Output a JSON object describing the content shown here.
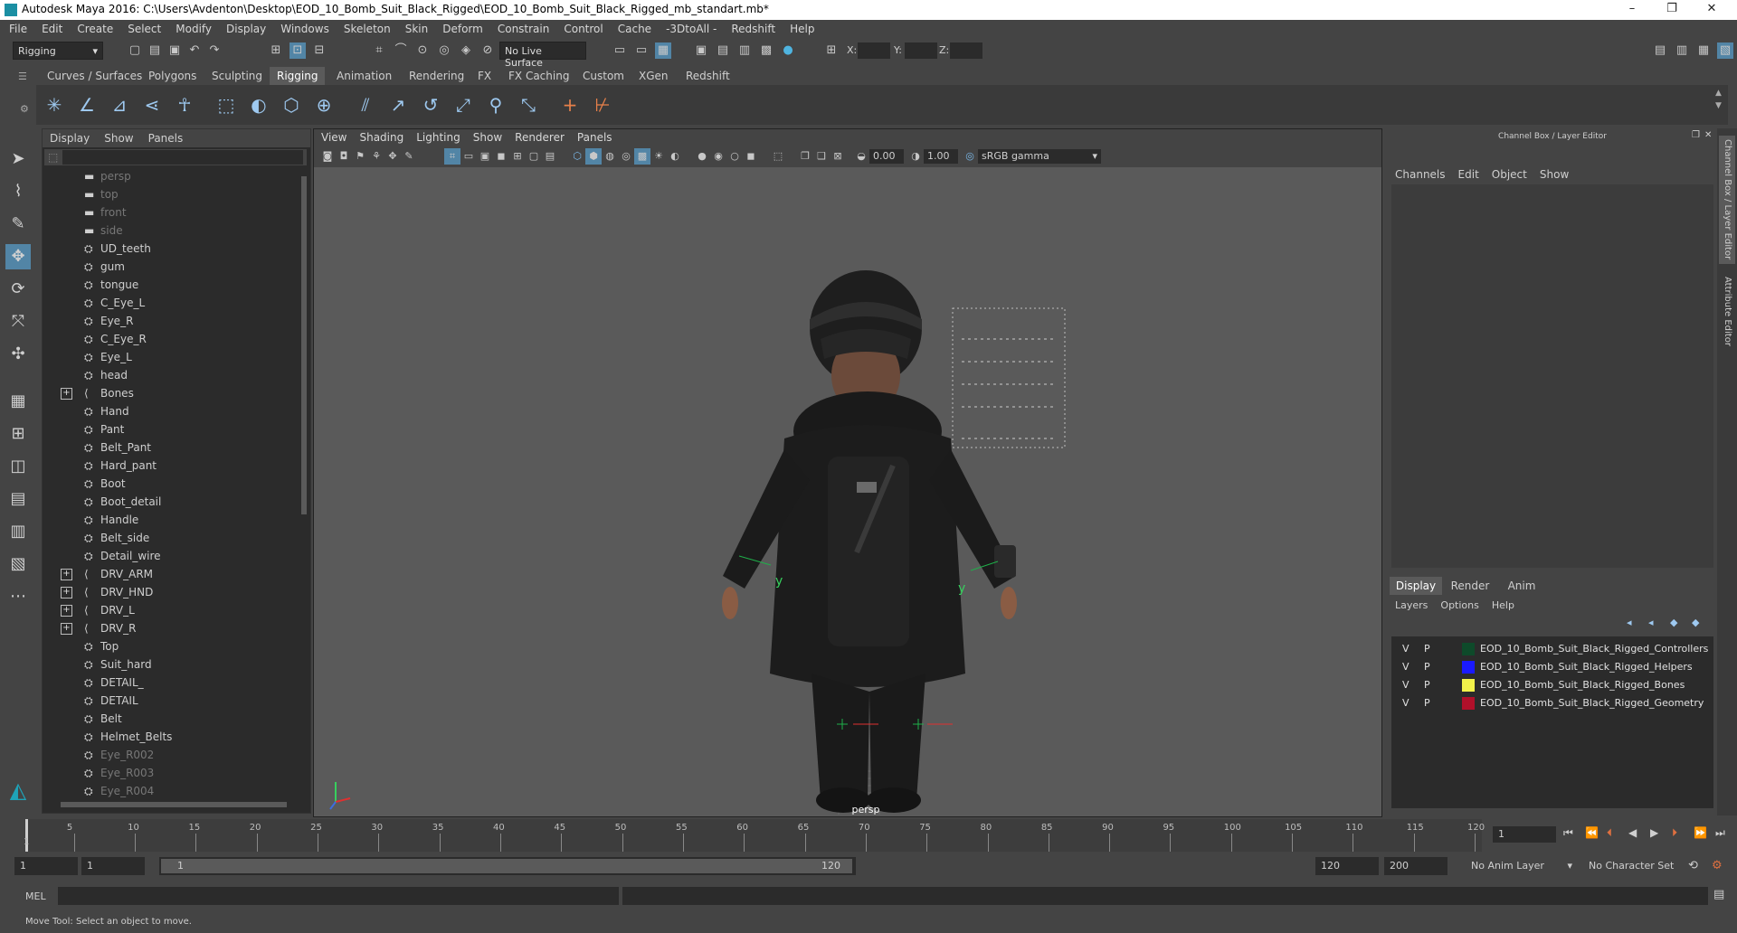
{
  "window": {
    "title": "Autodesk Maya 2016: C:\\Users\\Avdenton\\Desktop\\EOD_10_Bomb_Suit_Black_Rigged\\EOD_10_Bomb_Suit_Black_Rigged_mb_standart.mb*",
    "min": "–",
    "max": "❐",
    "close": "✕"
  },
  "menubar": [
    "File",
    "Edit",
    "Create",
    "Select",
    "Modify",
    "Display",
    "Windows",
    "Skeleton",
    "Skin",
    "Deform",
    "Constrain",
    "Control",
    "Cache",
    "-3DtoAll -",
    "Redshift",
    "Help"
  ],
  "statusline": {
    "mode": "Rigging",
    "live_surface": "No Live Surface",
    "x_label": "X:",
    "y_label": "Y:",
    "z_label": "Z:"
  },
  "shelf_tabs": [
    "Curves / Surfaces",
    "Polygons",
    "Sculpting",
    "Rigging",
    "Animation",
    "Rendering",
    "FX",
    "FX Caching",
    "Custom",
    "XGen",
    "Redshift"
  ],
  "active_shelf_tab": "Rigging",
  "outliner": {
    "menu": [
      "Display",
      "Show",
      "Panels"
    ],
    "items": [
      {
        "label": "persp",
        "icon": "camera",
        "dim": true
      },
      {
        "label": "top",
        "icon": "camera",
        "dim": true
      },
      {
        "label": "front",
        "icon": "camera",
        "dim": true
      },
      {
        "label": "side",
        "icon": "camera",
        "dim": true
      },
      {
        "label": "UD_teeth",
        "icon": "mesh"
      },
      {
        "label": "gum",
        "icon": "mesh"
      },
      {
        "label": "tongue",
        "icon": "mesh"
      },
      {
        "label": "C_Eye_L",
        "icon": "mesh"
      },
      {
        "label": "Eye_R",
        "icon": "mesh"
      },
      {
        "label": "C_Eye_R",
        "icon": "mesh"
      },
      {
        "label": "Eye_L",
        "icon": "mesh"
      },
      {
        "label": "head",
        "icon": "mesh"
      },
      {
        "label": "Bones",
        "icon": "joint",
        "expand": true
      },
      {
        "label": "Hand",
        "icon": "mesh"
      },
      {
        "label": "Pant",
        "icon": "mesh"
      },
      {
        "label": "Belt_Pant",
        "icon": "mesh"
      },
      {
        "label": "Hard_pant",
        "icon": "mesh"
      },
      {
        "label": "Boot",
        "icon": "mesh"
      },
      {
        "label": "Boot_detail",
        "icon": "mesh"
      },
      {
        "label": "Handle",
        "icon": "mesh"
      },
      {
        "label": "Belt_side",
        "icon": "mesh"
      },
      {
        "label": "Detail_wire",
        "icon": "mesh"
      },
      {
        "label": "DRV_ARM",
        "icon": "joint",
        "expand": true
      },
      {
        "label": "DRV_HND",
        "icon": "joint",
        "expand": true
      },
      {
        "label": "DRV_L",
        "icon": "joint",
        "expand": true
      },
      {
        "label": "DRV_R",
        "icon": "joint",
        "expand": true
      },
      {
        "label": "Top",
        "icon": "mesh"
      },
      {
        "label": "Suit_hard",
        "icon": "mesh"
      },
      {
        "label": "DETAIL_",
        "icon": "mesh"
      },
      {
        "label": "DETAIL",
        "icon": "mesh"
      },
      {
        "label": "Belt",
        "icon": "mesh"
      },
      {
        "label": "Helmet_Belts",
        "icon": "mesh"
      },
      {
        "label": "Eye_R002",
        "icon": "mesh",
        "dim": true
      },
      {
        "label": "Eye_R003",
        "icon": "mesh",
        "dim": true
      },
      {
        "label": "Eye_R004",
        "icon": "mesh",
        "dim": true
      }
    ]
  },
  "viewport": {
    "menu": [
      "View",
      "Shading",
      "Lighting",
      "Show",
      "Renderer",
      "Panels"
    ],
    "exposure": "0.00",
    "gamma": "1.00",
    "color_space": "sRGB gamma",
    "camera_label": "persp",
    "axis_y": "y"
  },
  "channelbox": {
    "title": "Channel Box / Layer Editor",
    "menu": [
      "Channels",
      "Edit",
      "Object",
      "Show"
    ],
    "layer_tabs": [
      "Display",
      "Render",
      "Anim"
    ],
    "layer_menu": [
      "Layers",
      "Options",
      "Help"
    ],
    "layers": [
      {
        "v": "V",
        "p": "P",
        "color": "#0e4a2a",
        "name": "EOD_10_Bomb_Suit_Black_Rigged_Controllers"
      },
      {
        "v": "V",
        "p": "P",
        "color": "#1a1aff",
        "name": "EOD_10_Bomb_Suit_Black_Rigged_Helpers"
      },
      {
        "v": "V",
        "p": "P",
        "color": "#f2f24a",
        "name": "EOD_10_Bomb_Suit_Black_Rigged_Bones"
      },
      {
        "v": "V",
        "p": "P",
        "color": "#b0102a",
        "name": "EOD_10_Bomb_Suit_Black_Rigged_Geometry"
      }
    ],
    "side_tab_1": "Channel Box / Layer Editor",
    "side_tab_2": "Attribute Editor"
  },
  "timeline": {
    "ticks": [
      "5",
      "10",
      "15",
      "20",
      "25",
      "30",
      "35",
      "40",
      "45",
      "50",
      "55",
      "60",
      "65",
      "70",
      "75",
      "80",
      "85",
      "90",
      "95",
      "100",
      "105",
      "110",
      "115",
      "120"
    ],
    "first_tick": "1",
    "current_frame": "1"
  },
  "range": {
    "start": "1",
    "start2": "1",
    "slider_start": "1",
    "slider_end": "120",
    "end": "120",
    "end2": "200",
    "anim_layer": "No Anim Layer",
    "char_set": "No Character Set"
  },
  "cmd": {
    "label": "MEL"
  },
  "help": {
    "text": "Move Tool: Select an object to move."
  }
}
